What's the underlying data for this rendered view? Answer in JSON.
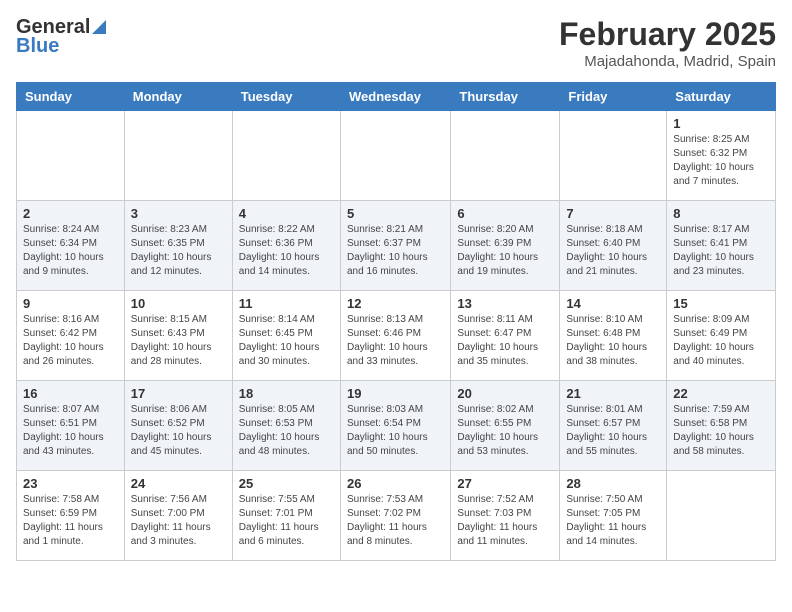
{
  "header": {
    "logo_general": "General",
    "logo_blue": "Blue",
    "title": "February 2025",
    "subtitle": "Majadahonda, Madrid, Spain"
  },
  "days_of_week": [
    "Sunday",
    "Monday",
    "Tuesday",
    "Wednesday",
    "Thursday",
    "Friday",
    "Saturday"
  ],
  "weeks": [
    [
      {
        "day": "",
        "info": ""
      },
      {
        "day": "",
        "info": ""
      },
      {
        "day": "",
        "info": ""
      },
      {
        "day": "",
        "info": ""
      },
      {
        "day": "",
        "info": ""
      },
      {
        "day": "",
        "info": ""
      },
      {
        "day": "1",
        "info": "Sunrise: 8:25 AM\nSunset: 6:32 PM\nDaylight: 10 hours and 7 minutes."
      }
    ],
    [
      {
        "day": "2",
        "info": "Sunrise: 8:24 AM\nSunset: 6:34 PM\nDaylight: 10 hours and 9 minutes."
      },
      {
        "day": "3",
        "info": "Sunrise: 8:23 AM\nSunset: 6:35 PM\nDaylight: 10 hours and 12 minutes."
      },
      {
        "day": "4",
        "info": "Sunrise: 8:22 AM\nSunset: 6:36 PM\nDaylight: 10 hours and 14 minutes."
      },
      {
        "day": "5",
        "info": "Sunrise: 8:21 AM\nSunset: 6:37 PM\nDaylight: 10 hours and 16 minutes."
      },
      {
        "day": "6",
        "info": "Sunrise: 8:20 AM\nSunset: 6:39 PM\nDaylight: 10 hours and 19 minutes."
      },
      {
        "day": "7",
        "info": "Sunrise: 8:18 AM\nSunset: 6:40 PM\nDaylight: 10 hours and 21 minutes."
      },
      {
        "day": "8",
        "info": "Sunrise: 8:17 AM\nSunset: 6:41 PM\nDaylight: 10 hours and 23 minutes."
      }
    ],
    [
      {
        "day": "9",
        "info": "Sunrise: 8:16 AM\nSunset: 6:42 PM\nDaylight: 10 hours and 26 minutes."
      },
      {
        "day": "10",
        "info": "Sunrise: 8:15 AM\nSunset: 6:43 PM\nDaylight: 10 hours and 28 minutes."
      },
      {
        "day": "11",
        "info": "Sunrise: 8:14 AM\nSunset: 6:45 PM\nDaylight: 10 hours and 30 minutes."
      },
      {
        "day": "12",
        "info": "Sunrise: 8:13 AM\nSunset: 6:46 PM\nDaylight: 10 hours and 33 minutes."
      },
      {
        "day": "13",
        "info": "Sunrise: 8:11 AM\nSunset: 6:47 PM\nDaylight: 10 hours and 35 minutes."
      },
      {
        "day": "14",
        "info": "Sunrise: 8:10 AM\nSunset: 6:48 PM\nDaylight: 10 hours and 38 minutes."
      },
      {
        "day": "15",
        "info": "Sunrise: 8:09 AM\nSunset: 6:49 PM\nDaylight: 10 hours and 40 minutes."
      }
    ],
    [
      {
        "day": "16",
        "info": "Sunrise: 8:07 AM\nSunset: 6:51 PM\nDaylight: 10 hours and 43 minutes."
      },
      {
        "day": "17",
        "info": "Sunrise: 8:06 AM\nSunset: 6:52 PM\nDaylight: 10 hours and 45 minutes."
      },
      {
        "day": "18",
        "info": "Sunrise: 8:05 AM\nSunset: 6:53 PM\nDaylight: 10 hours and 48 minutes."
      },
      {
        "day": "19",
        "info": "Sunrise: 8:03 AM\nSunset: 6:54 PM\nDaylight: 10 hours and 50 minutes."
      },
      {
        "day": "20",
        "info": "Sunrise: 8:02 AM\nSunset: 6:55 PM\nDaylight: 10 hours and 53 minutes."
      },
      {
        "day": "21",
        "info": "Sunrise: 8:01 AM\nSunset: 6:57 PM\nDaylight: 10 hours and 55 minutes."
      },
      {
        "day": "22",
        "info": "Sunrise: 7:59 AM\nSunset: 6:58 PM\nDaylight: 10 hours and 58 minutes."
      }
    ],
    [
      {
        "day": "23",
        "info": "Sunrise: 7:58 AM\nSunset: 6:59 PM\nDaylight: 11 hours and 1 minute."
      },
      {
        "day": "24",
        "info": "Sunrise: 7:56 AM\nSunset: 7:00 PM\nDaylight: 11 hours and 3 minutes."
      },
      {
        "day": "25",
        "info": "Sunrise: 7:55 AM\nSunset: 7:01 PM\nDaylight: 11 hours and 6 minutes."
      },
      {
        "day": "26",
        "info": "Sunrise: 7:53 AM\nSunset: 7:02 PM\nDaylight: 11 hours and 8 minutes."
      },
      {
        "day": "27",
        "info": "Sunrise: 7:52 AM\nSunset: 7:03 PM\nDaylight: 11 hours and 11 minutes."
      },
      {
        "day": "28",
        "info": "Sunrise: 7:50 AM\nSunset: 7:05 PM\nDaylight: 11 hours and 14 minutes."
      },
      {
        "day": "",
        "info": ""
      }
    ]
  ]
}
